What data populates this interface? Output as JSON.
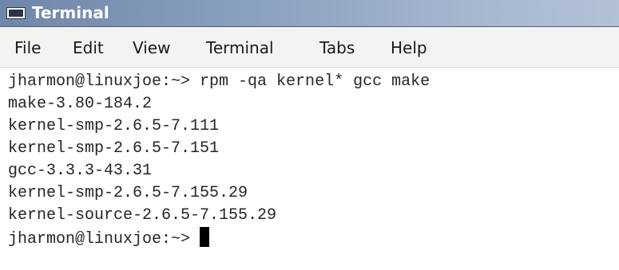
{
  "window": {
    "title": "Terminal",
    "icon": "terminal-icon"
  },
  "menubar": {
    "items": [
      "File",
      "Edit",
      "View",
      "Terminal",
      "Tabs",
      "Help"
    ]
  },
  "terminal": {
    "lines": [
      "jharmon@linuxjoe:~> rpm -qa kernel* gcc make",
      "make-3.80-184.2",
      "kernel-smp-2.6.5-7.111",
      "kernel-smp-2.6.5-7.151",
      "gcc-3.3.3-43.31",
      "kernel-smp-2.6.5-7.155.29",
      "kernel-source-2.6.5-7.155.29"
    ],
    "prompt": "jharmon@linuxjoe:~> "
  },
  "colors": {
    "titlebar": "#8aa0bf",
    "menubar": "#f3f3f2",
    "terminal_bg": "#ffffff",
    "terminal_fg": "#262626"
  }
}
